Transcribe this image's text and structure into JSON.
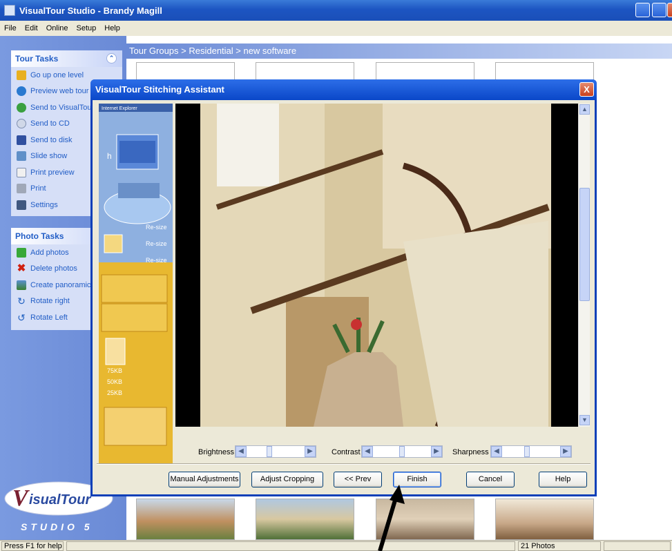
{
  "window": {
    "title": "VisualTour Studio - Brandy Magill"
  },
  "menu": [
    "File",
    "Edit",
    "Online",
    "Setup",
    "Help"
  ],
  "tour_tasks": {
    "header": "Tour Tasks",
    "items": [
      "Go up one level",
      "Preview web tour",
      "Send to VisualTour",
      "Send to CD",
      "Send to disk",
      "Slide show",
      "Print preview",
      "Print",
      "Settings"
    ]
  },
  "photo_tasks": {
    "header": "Photo Tasks",
    "items": [
      "Add photos",
      "Delete photos",
      "Create panoramic",
      "Rotate right",
      "Rotate Left"
    ]
  },
  "breadcrumb": "Tour Groups > Residential > new software",
  "brand": {
    "name": "VisualTour",
    "sub": "STUDIO 5"
  },
  "dialog": {
    "title": "VisualTour Stitching Assistant",
    "close": "X",
    "side_graphic": {
      "title": "Internet Explorer",
      "resize": "Re-size",
      "sizes": [
        "75KB",
        "50KB",
        "25KB"
      ]
    },
    "sliders": [
      {
        "label": "Brightness",
        "value": 0.38
      },
      {
        "label": "Contrast",
        "value": 0.5
      },
      {
        "label": "Sharpness",
        "value": 0.42
      }
    ],
    "buttons": {
      "manual": "Manual Adjustments",
      "cropping": "Adjust Cropping",
      "prev": "<< Prev",
      "finish": "Finish",
      "cancel": "Cancel",
      "help": "Help"
    }
  },
  "status": {
    "left": "Press F1 for help",
    "right": "21 Photos"
  }
}
